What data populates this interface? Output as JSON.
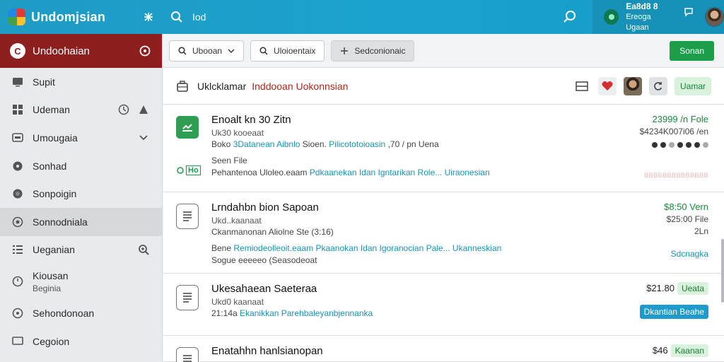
{
  "topbar": {
    "brand": "Undomjsian",
    "search_label": "Iod",
    "user_line1": "Ea8d8 8",
    "user_line2": "Ereoga Ugaan"
  },
  "sidebar": {
    "header": "Undoohaian",
    "items": [
      {
        "label": "Supit"
      },
      {
        "label": "Udeman"
      },
      {
        "label": "Umougaia"
      },
      {
        "label": "Sonhad"
      },
      {
        "label": "Sonpoigin"
      },
      {
        "label": "Sonnodniala"
      },
      {
        "label": "Ueganian"
      },
      {
        "label": "Kiousan",
        "sub": "Beginia"
      },
      {
        "label": "Sehondonoan"
      },
      {
        "label": "Cegoion"
      }
    ]
  },
  "toolbar": {
    "btn1": "Ubooan",
    "btn2": "Uloioentaix",
    "btn3": "Sedconionaic",
    "primary": "Sonan"
  },
  "panel": {
    "title": "Uklcklamar",
    "title_red": "Inddooan Uokonnsian",
    "action_pill": "Uamar"
  },
  "rows": [
    {
      "title": "Enoalt kn 30 Zitn",
      "sub": "Uk30 kooeaat",
      "meta1_a": "Boko",
      "meta1_link": "3Datanean Aibnlo",
      "meta1_b": "Sioen.",
      "meta1_link2": "Pilicototoioasin",
      "meta1_c": ",70 / pn Uena",
      "meta2": "Seen File",
      "meta3_a": "Pehantenoa Uloleo.eaam",
      "meta3_link": "Pdkaanekan Idan Igntarikan Role... Uiraonesian",
      "flag": "Ho",
      "price": "23999 /n Fole",
      "price_sub": "$4234K007i06 /en",
      "faint": "BBBBBBBBBBBBBB"
    },
    {
      "title": "Lrndahbn bion Sapoan",
      "sub": "Ukd..kaanaat",
      "meta1": "Ckanmanonan Aliolne Ste (3:16)",
      "meta2_a": "Bene",
      "meta2_link": "Remiodeolleoit.eaam",
      "meta2_link2": "Pkaanokan Idan Igoranocian Pale... Ukanneskian",
      "meta3": "Sogue eeeeeo (Seasodeoat",
      "price": "$8:50 Vern",
      "price_sub": "$25:00 File",
      "price_sub2": "2Ln",
      "link": "Sdcnagka"
    },
    {
      "title": "Ukesahaean Saeteraa",
      "sub": "Ukd0 kaanaat",
      "meta_a": "21:14a",
      "meta_link": "Ekanikkan Parehbaleyanbjennanka",
      "price": "$21.80",
      "badge": "Ueata",
      "badge_blue": "Dkantian Beahe"
    },
    {
      "title": "Enatahhn hanlsianopan",
      "price": "$46",
      "badge": "Kaanan"
    }
  ]
}
